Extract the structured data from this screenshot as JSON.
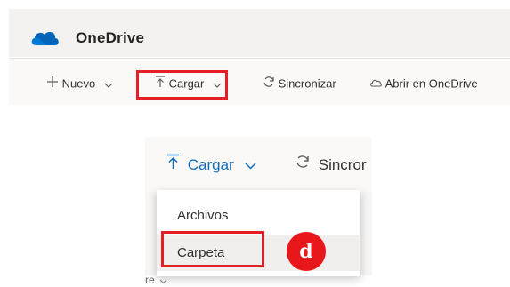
{
  "app": {
    "title": "OneDrive",
    "logo_icon": "onedrive-cloud-icon",
    "brand_color": "#0364b8"
  },
  "command_bar": {
    "nuevo_label": "Nuevo",
    "cargar_label": "Cargar",
    "sincronizar_label": "Sincronizar",
    "abrir_label": "Abrir en OneDrive"
  },
  "zoom": {
    "cargar_label": "Cargar",
    "sincronizar_partial": "Sincror",
    "menu_items": [
      "Archivos",
      "Carpeta"
    ],
    "badge_label": "d",
    "under_text": "re"
  },
  "colors": {
    "highlight_red": "#e31e24",
    "accent_blue": "#0f6cbd"
  }
}
